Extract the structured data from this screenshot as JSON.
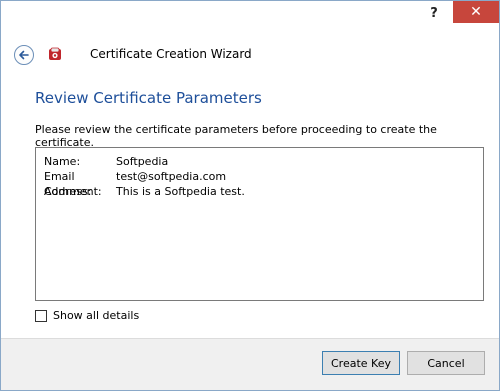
{
  "titlebar": {
    "help_label": "?",
    "close_label": "✕"
  },
  "header": {
    "back_icon": "back-arrow-icon",
    "app_icon": "certificate-app-icon",
    "title": "Certificate Creation Wizard"
  },
  "main": {
    "heading": "Review Certificate Parameters",
    "instruction": "Please review the certificate parameters before proceeding to create the certificate.",
    "details": [
      {
        "label": "Name:",
        "value": "Softpedia"
      },
      {
        "label": "Email Address:",
        "value": "test@softpedia.com"
      },
      {
        "label": "Comment:",
        "value": "This is a Softpedia test."
      }
    ],
    "show_all_details_label": "Show all details",
    "show_all_details_checked": false
  },
  "footer": {
    "create_key_label": "Create Key",
    "cancel_label": "Cancel"
  },
  "colors": {
    "heading": "#1e4f9a",
    "close_button": "#c7463c",
    "footer_bg": "#f0f0f0"
  }
}
